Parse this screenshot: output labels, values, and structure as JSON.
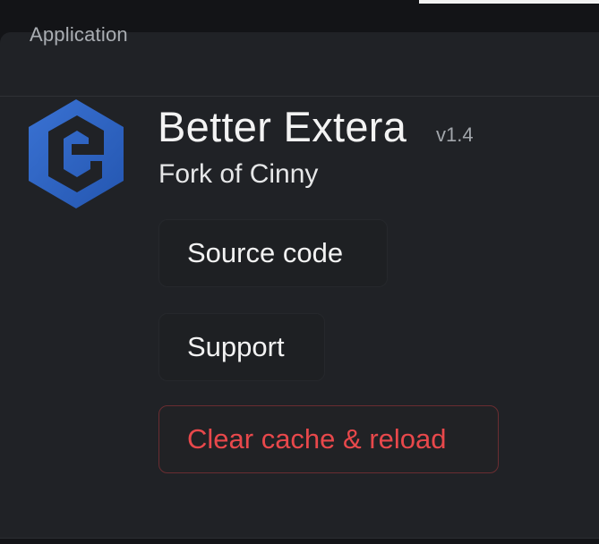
{
  "section": {
    "title": "Application"
  },
  "app": {
    "name": "Better Extera",
    "version": "v1.4",
    "subtitle": "Fork of Cinny",
    "logo_icon": "better-extera-logo-icon",
    "logo_color": "#2f66c8"
  },
  "actions": {
    "source_code_label": "Source code",
    "support_label": "Support",
    "clear_cache_label": "Clear cache & reload",
    "danger_color": "#e8484b"
  }
}
